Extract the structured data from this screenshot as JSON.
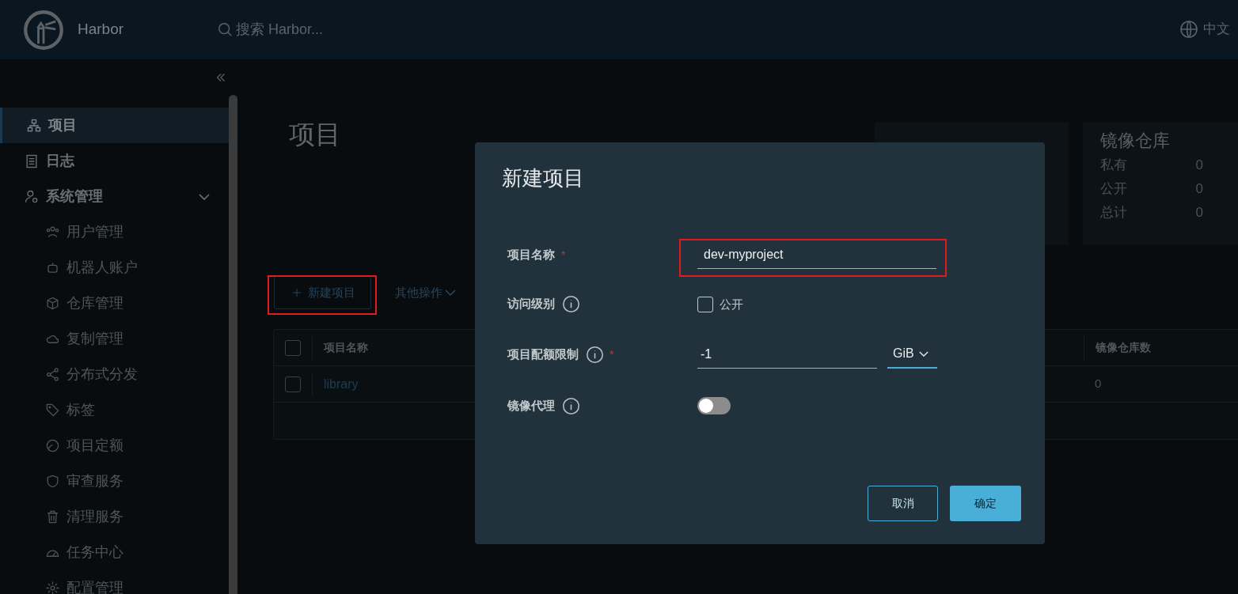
{
  "header": {
    "logo_text": "Harbor",
    "search_placeholder": "搜索 Harbor...",
    "language": "中文"
  },
  "sidebar": {
    "items": [
      {
        "label": "项目",
        "selected": true
      },
      {
        "label": "日志",
        "selected": false
      },
      {
        "label": "系统管理",
        "selected": false,
        "expanded": true,
        "children": [
          {
            "label": "用户管理",
            "selected": false
          },
          {
            "label": "机器人账户",
            "selected": false
          },
          {
            "label": "仓库管理",
            "selected": false
          },
          {
            "label": "复制管理",
            "selected": false
          },
          {
            "label": "分布式分发",
            "selected": false
          },
          {
            "label": "标签",
            "selected": false
          },
          {
            "label": "项目定额",
            "selected": false
          },
          {
            "label": "审查服务",
            "selected": false
          },
          {
            "label": "清理服务",
            "selected": false
          },
          {
            "label": "任务中心",
            "selected": false
          },
          {
            "label": "配置管理",
            "selected": false
          }
        ]
      }
    ]
  },
  "page_title": "项目",
  "stats": [
    {
      "kind": "summary"
    },
    {
      "kind": "summary",
      "title": "镜像仓库",
      "rows": [
        {
          "label": "私有",
          "value": "0"
        },
        {
          "label": "公开",
          "value": "0"
        },
        {
          "label": "总计",
          "value": "0"
        }
      ]
    }
  ],
  "toolbar": {
    "new_button": "新建项目",
    "new_button_highlighted": true,
    "more_button": "其他操作"
  },
  "table": {
    "select_all_checked": false,
    "columns": [
      "项目名称",
      "镜像仓库数"
    ],
    "rows": [
      {
        "name": "library",
        "repo_count": "0",
        "checked": false
      }
    ]
  },
  "dialog": {
    "title": "新建项目",
    "fields": [
      {
        "kind": "text",
        "label": "项目名称",
        "required_mark": "*",
        "value": "dev-myproject",
        "highlighted": true
      },
      {
        "kind": "checkbox",
        "label": "访问级别",
        "info": true,
        "option": "公开",
        "checked": false
      },
      {
        "kind": "quota",
        "label": "项目配额限制",
        "info": true,
        "required_mark": "*",
        "value": "-1",
        "unit": "GiB"
      },
      {
        "kind": "toggle",
        "label": "镜像代理",
        "info": true,
        "on": false
      }
    ],
    "cancel": "取消",
    "ok": "确定"
  }
}
